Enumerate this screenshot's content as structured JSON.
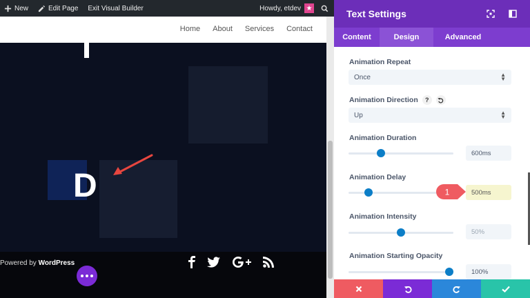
{
  "admin_bar": {
    "new_label": "New",
    "edit_label": "Edit Page",
    "exit_label": "Exit Visual Builder",
    "howdy_label": "Howdy, etdev"
  },
  "site_nav": [
    "Home",
    "About",
    "Services",
    "Contact"
  ],
  "hero": {
    "letter": "D"
  },
  "footer": {
    "powered_prefix": "Powered by ",
    "powered_brand": "WordPress"
  },
  "panel": {
    "title": "Text Settings",
    "tabs": [
      "Content",
      "Design",
      "Advanced"
    ],
    "active_tab": "Design",
    "fields": {
      "repeat": {
        "label": "Animation Repeat",
        "value": "Once"
      },
      "direction": {
        "label": "Animation Direction",
        "value": "Up",
        "help_icon": "?"
      },
      "duration": {
        "label": "Animation Duration",
        "value": "600ms",
        "slider_fraction": 0.31
      },
      "delay": {
        "label": "Animation Delay",
        "value": "500ms",
        "slider_fraction": 0.19
      },
      "intensity": {
        "label": "Animation Intensity",
        "value": "50%",
        "slider_fraction": 0.5
      },
      "opacity": {
        "label": "Animation Starting Opacity",
        "value": "100%",
        "slider_fraction": 0.96
      }
    }
  },
  "callout": {
    "number": "1"
  },
  "colors": {
    "panel_header": "#6c2eb9",
    "tabs_bar": "#7d3dcf",
    "close": "#ef5b61",
    "undo": "#7b2bd6",
    "redo": "#2b87da",
    "save": "#29c4a9",
    "slider_knob": "#0c7ec7",
    "callout": "#ef5b61"
  }
}
